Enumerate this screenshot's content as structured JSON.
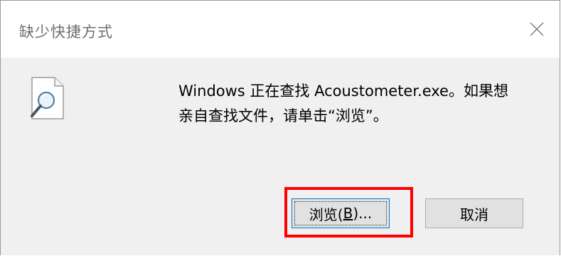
{
  "window": {
    "title": "缺少快捷方式",
    "close_icon": "close-icon"
  },
  "message": {
    "line1": "Windows 正在查找 Acoustometer.exe。如果想",
    "line2": "亲自查找文件，请单击“浏览”。"
  },
  "icon": {
    "name": "file-search-icon"
  },
  "buttons": {
    "browse_label_prefix": "浏览(",
    "browse_label_mnemonic": "B",
    "browse_label_suffix": ")...",
    "cancel_label": "取消"
  },
  "colors": {
    "highlight": "#ff0000",
    "dialog_bg": "#f0f0f0",
    "button_bg": "#e1e1e1",
    "focus_border": "#0078d7"
  }
}
